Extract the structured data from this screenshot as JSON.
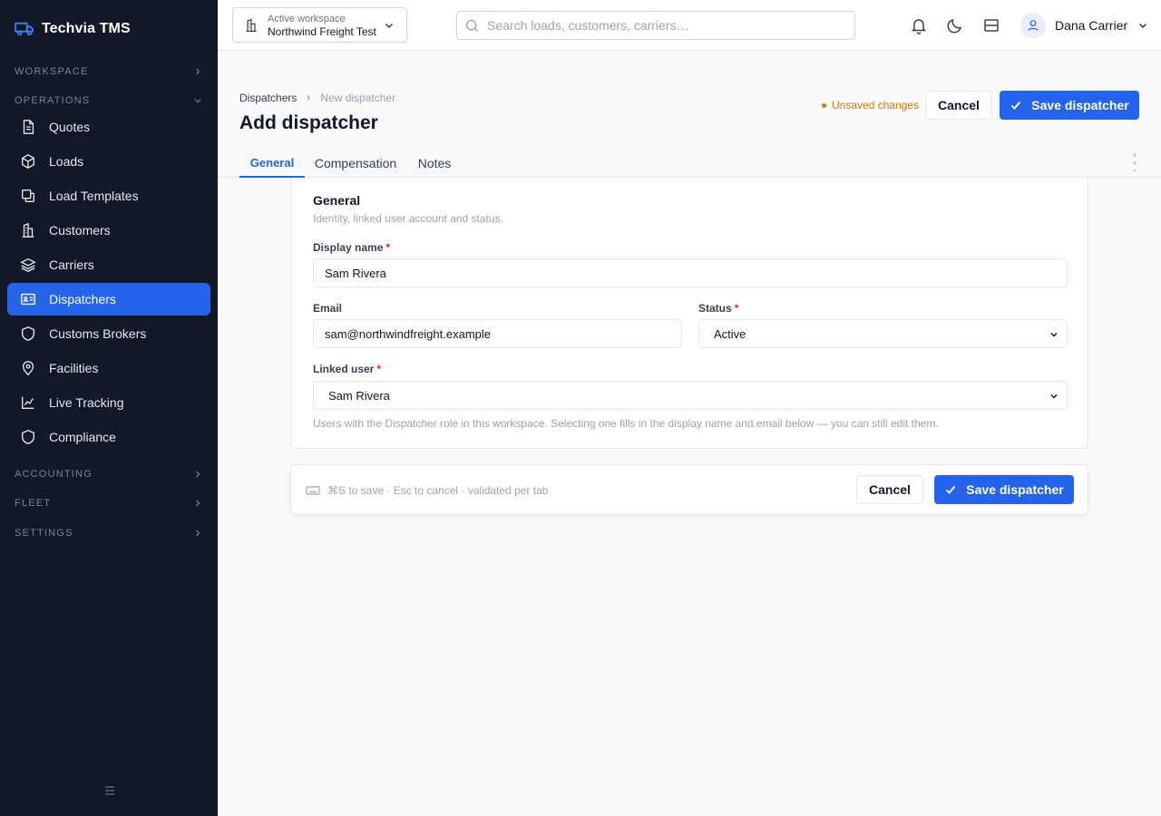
{
  "app": {
    "brand": "Techvia TMS",
    "accent": "#2563eb",
    "sidebar_bg": "#111827"
  },
  "sidebar": {
    "sections": {
      "workspace": "WORKSPACE",
      "operations": "OPERATIONS",
      "accounting": "ACCOUNTING",
      "fleet": "FLEET",
      "settings": "SETTINGS"
    },
    "items": [
      {
        "label": "Quotes",
        "icon": "document-icon"
      },
      {
        "label": "Loads",
        "icon": "box-icon"
      },
      {
        "label": "Load Templates",
        "icon": "copy-icon"
      },
      {
        "label": "Customers",
        "icon": "building-icon"
      },
      {
        "label": "Carriers",
        "icon": "layers-icon"
      },
      {
        "label": "Dispatchers",
        "icon": "id-card-icon",
        "active": true
      },
      {
        "label": "Customs Brokers",
        "icon": "shield-icon"
      },
      {
        "label": "Facilities",
        "icon": "map-pin-icon"
      },
      {
        "label": "Live Tracking",
        "icon": "chart-line-icon"
      },
      {
        "label": "Compliance",
        "icon": "shield-icon"
      }
    ]
  },
  "topbar": {
    "workspace_caption": "Active workspace",
    "workspace_name": "Northwind Freight Test",
    "search_placeholder": "Search loads, customers, carriers…",
    "user_name": "Dana Carrier"
  },
  "header": {
    "breadcrumb_root": "Dispatchers",
    "breadcrumb_current": "New dispatcher",
    "title": "Add dispatcher",
    "unsaved": "Unsaved changes",
    "cancel": "Cancel",
    "save": "Save dispatcher"
  },
  "tabs": [
    "General",
    "Compensation",
    "Notes"
  ],
  "form": {
    "section_title": "General",
    "section_subtitle": "Identity, linked user account and status.",
    "display_name_label": "Display name",
    "display_name_value": "Sam Rivera",
    "email_label": "Email",
    "email_value": "sam@northwindfreight.example",
    "status_label": "Status",
    "status_value": "Active",
    "linked_user_label": "Linked user",
    "linked_user_value": "Sam Rivera",
    "required_mark": "*",
    "help": "Users with the Dispatcher role in this workspace. Selecting one fills in the display name and email below — you can still edit them."
  },
  "footer": {
    "hint": "⌘S to save · Esc to cancel · validated per tab",
    "cancel": "Cancel",
    "save": "Save dispatcher"
  }
}
